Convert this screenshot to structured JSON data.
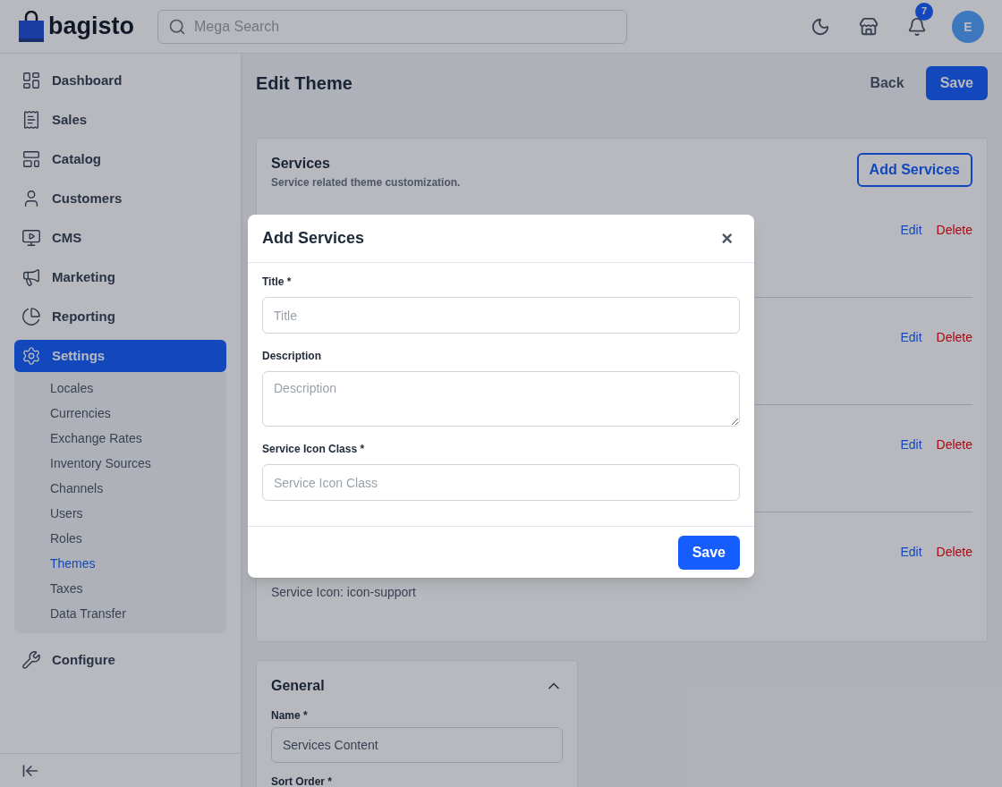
{
  "header": {
    "logo": "bagisto",
    "search": {
      "placeholder": "Mega Search"
    },
    "notifications": "7",
    "avatar": "E"
  },
  "sidebar": {
    "items": [
      {
        "label": "Dashboard",
        "selected": false
      },
      {
        "label": "Sales",
        "selected": false
      },
      {
        "label": "Catalog",
        "selected": false
      },
      {
        "label": "Customers",
        "selected": false
      },
      {
        "label": "CMS",
        "selected": false
      },
      {
        "label": "Marketing",
        "selected": false
      },
      {
        "label": "Reporting",
        "selected": false
      },
      {
        "label": "Settings",
        "selected": true,
        "children": [
          {
            "label": "Locales",
            "selected": false
          },
          {
            "label": "Currencies",
            "selected": false
          },
          {
            "label": "Exchange Rates",
            "selected": false
          },
          {
            "label": "Inventory Sources",
            "selected": false
          },
          {
            "label": "Channels",
            "selected": false
          },
          {
            "label": "Users",
            "selected": false
          },
          {
            "label": "Roles",
            "selected": false
          },
          {
            "label": "Themes",
            "selected": true
          },
          {
            "label": "Taxes",
            "selected": false
          },
          {
            "label": "Data Transfer",
            "selected": false
          }
        ]
      },
      {
        "label": "Configure",
        "selected": false
      }
    ]
  },
  "page": {
    "title": "Edit Theme",
    "back": "Back",
    "save": "Save"
  },
  "services": {
    "title": "Services",
    "subtitle": "Service related theme customization.",
    "add_button": "Add Services",
    "rows": [
      {
        "lines": [],
        "edit": "Edit",
        "delete": "Delete"
      },
      {
        "lines": [],
        "edit": "Edit",
        "delete": "Delete"
      },
      {
        "lines": [],
        "edit": "Edit",
        "delete": "Delete"
      },
      {
        "lines": [
          "Service Icon: icon-support"
        ],
        "edit": "Edit",
        "delete": "Delete"
      }
    ]
  },
  "general": {
    "title": "General",
    "expanded": true,
    "fields": [
      {
        "label": "Name *",
        "value": "Services Content"
      },
      {
        "label": "Sort Order *"
      }
    ]
  },
  "modal": {
    "title": "Add Services",
    "close": "×",
    "fields": [
      {
        "kind": "input",
        "label": "Title *",
        "placeholder": "Title"
      },
      {
        "kind": "textarea",
        "label": "Description",
        "placeholder": "Description"
      },
      {
        "kind": "input",
        "label": "Service Icon Class *",
        "placeholder": "Service Icon Class"
      }
    ],
    "save": "Save"
  }
}
